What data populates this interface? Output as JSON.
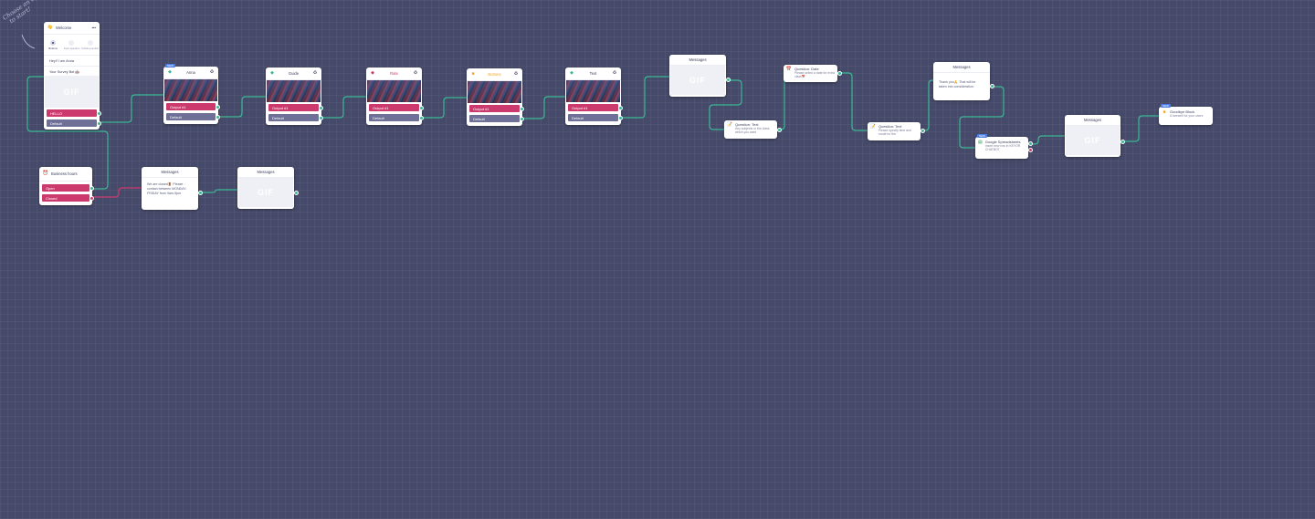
{
  "annotation": "Choose an option\n  to start!",
  "welcome": {
    "title": "Welcome",
    "menu": "•••",
    "tabs": [
      "Buttons",
      "Input question",
      "Fields question"
    ],
    "fields": [
      "Hey!! I am Anna",
      "Your Survey Bot 🤖"
    ],
    "gif": "GIF",
    "rows": [
      "HELLO",
      "Default"
    ]
  },
  "media_nodes": [
    {
      "title": "Anna",
      "badge": "NEW",
      "color": "#3ab795",
      "rows": [
        "Output #1",
        "Default"
      ]
    },
    {
      "title": "Guide",
      "badge": "",
      "color": "#3ab795",
      "rows": [
        "Output #1",
        "Default"
      ]
    },
    {
      "title": "Rate",
      "badge": "",
      "color": "#cc3a6d",
      "rows": [
        "Output #1",
        "Default"
      ]
    },
    {
      "title": "Buttons",
      "badge": "",
      "color": "#f5a623",
      "rows": [
        "Output #1",
        "Default"
      ]
    },
    {
      "title": "Text",
      "badge": "",
      "color": "#3ab795",
      "rows": [
        "Output #1",
        "Default"
      ]
    }
  ],
  "messages_1": {
    "title": "Messages",
    "gif": "GIF"
  },
  "question_text_1": {
    "title": "Question: Text",
    "text": "Any subjects or the class which you want"
  },
  "question_date": {
    "title": "Question: Date",
    "text": "Please select a date for extra class📅"
  },
  "question_text_2": {
    "title": "Question: Text",
    "text": "Please specify time and mode for the"
  },
  "messages_thanks": {
    "title": "Messages",
    "text": "Thank you🙏 That will be taken into consideration."
  },
  "spreadsheet": {
    "badge": "NEW",
    "title": "Google Spreadsheets",
    "text": "Insert new row in KEYOR CHATBOT"
  },
  "messages_2": {
    "title": "Messages",
    "gif": "GIF"
  },
  "goodbye": {
    "badge": "NEW",
    "title": "Goodbye Block",
    "text": "A farewell for your users"
  },
  "business_hours": {
    "title": "Business hours",
    "rows": [
      "Open",
      "Closed"
    ]
  },
  "messages_closed": {
    "title": "Messages",
    "text": "We are closed🚪 Please contact between MONDAY-FRIDAY from 9am-5pm"
  },
  "messages_3": {
    "title": "Messages",
    "gif": "GIF"
  },
  "colors": {
    "background": "#464a6a",
    "wire_green": "#3ab795",
    "wire_red": "#cc3a6d",
    "row_pink": "#cc3a6d",
    "row_purple": "#6e7097"
  }
}
